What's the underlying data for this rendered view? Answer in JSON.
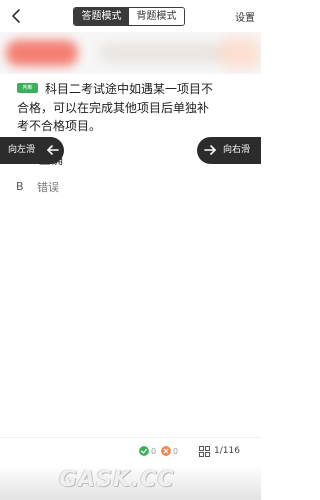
{
  "header": {
    "back_icon": "chevron-left-icon",
    "tabs": [
      {
        "label": "答题模式",
        "active": true
      },
      {
        "label": "背题模式",
        "active": false
      }
    ],
    "settings_label": "设置"
  },
  "question": {
    "type_badge": "判断",
    "lines": [
      "科目二考试途中如遇某一项目不",
      "合格，可以在完成其他项目后单独补",
      "考不合格项目。"
    ],
    "options": [
      {
        "letter": "A",
        "text": "正确"
      },
      {
        "letter": "B",
        "text": "错误"
      }
    ]
  },
  "swipe": {
    "left_label": "向左滑",
    "right_label": "向右滑"
  },
  "footer": {
    "correct_count": "0",
    "wrong_count": "0",
    "progress": "1/116",
    "colors": {
      "correct": "#3ab05c",
      "wrong": "#f0834d"
    }
  },
  "watermark": "GASK.CC"
}
